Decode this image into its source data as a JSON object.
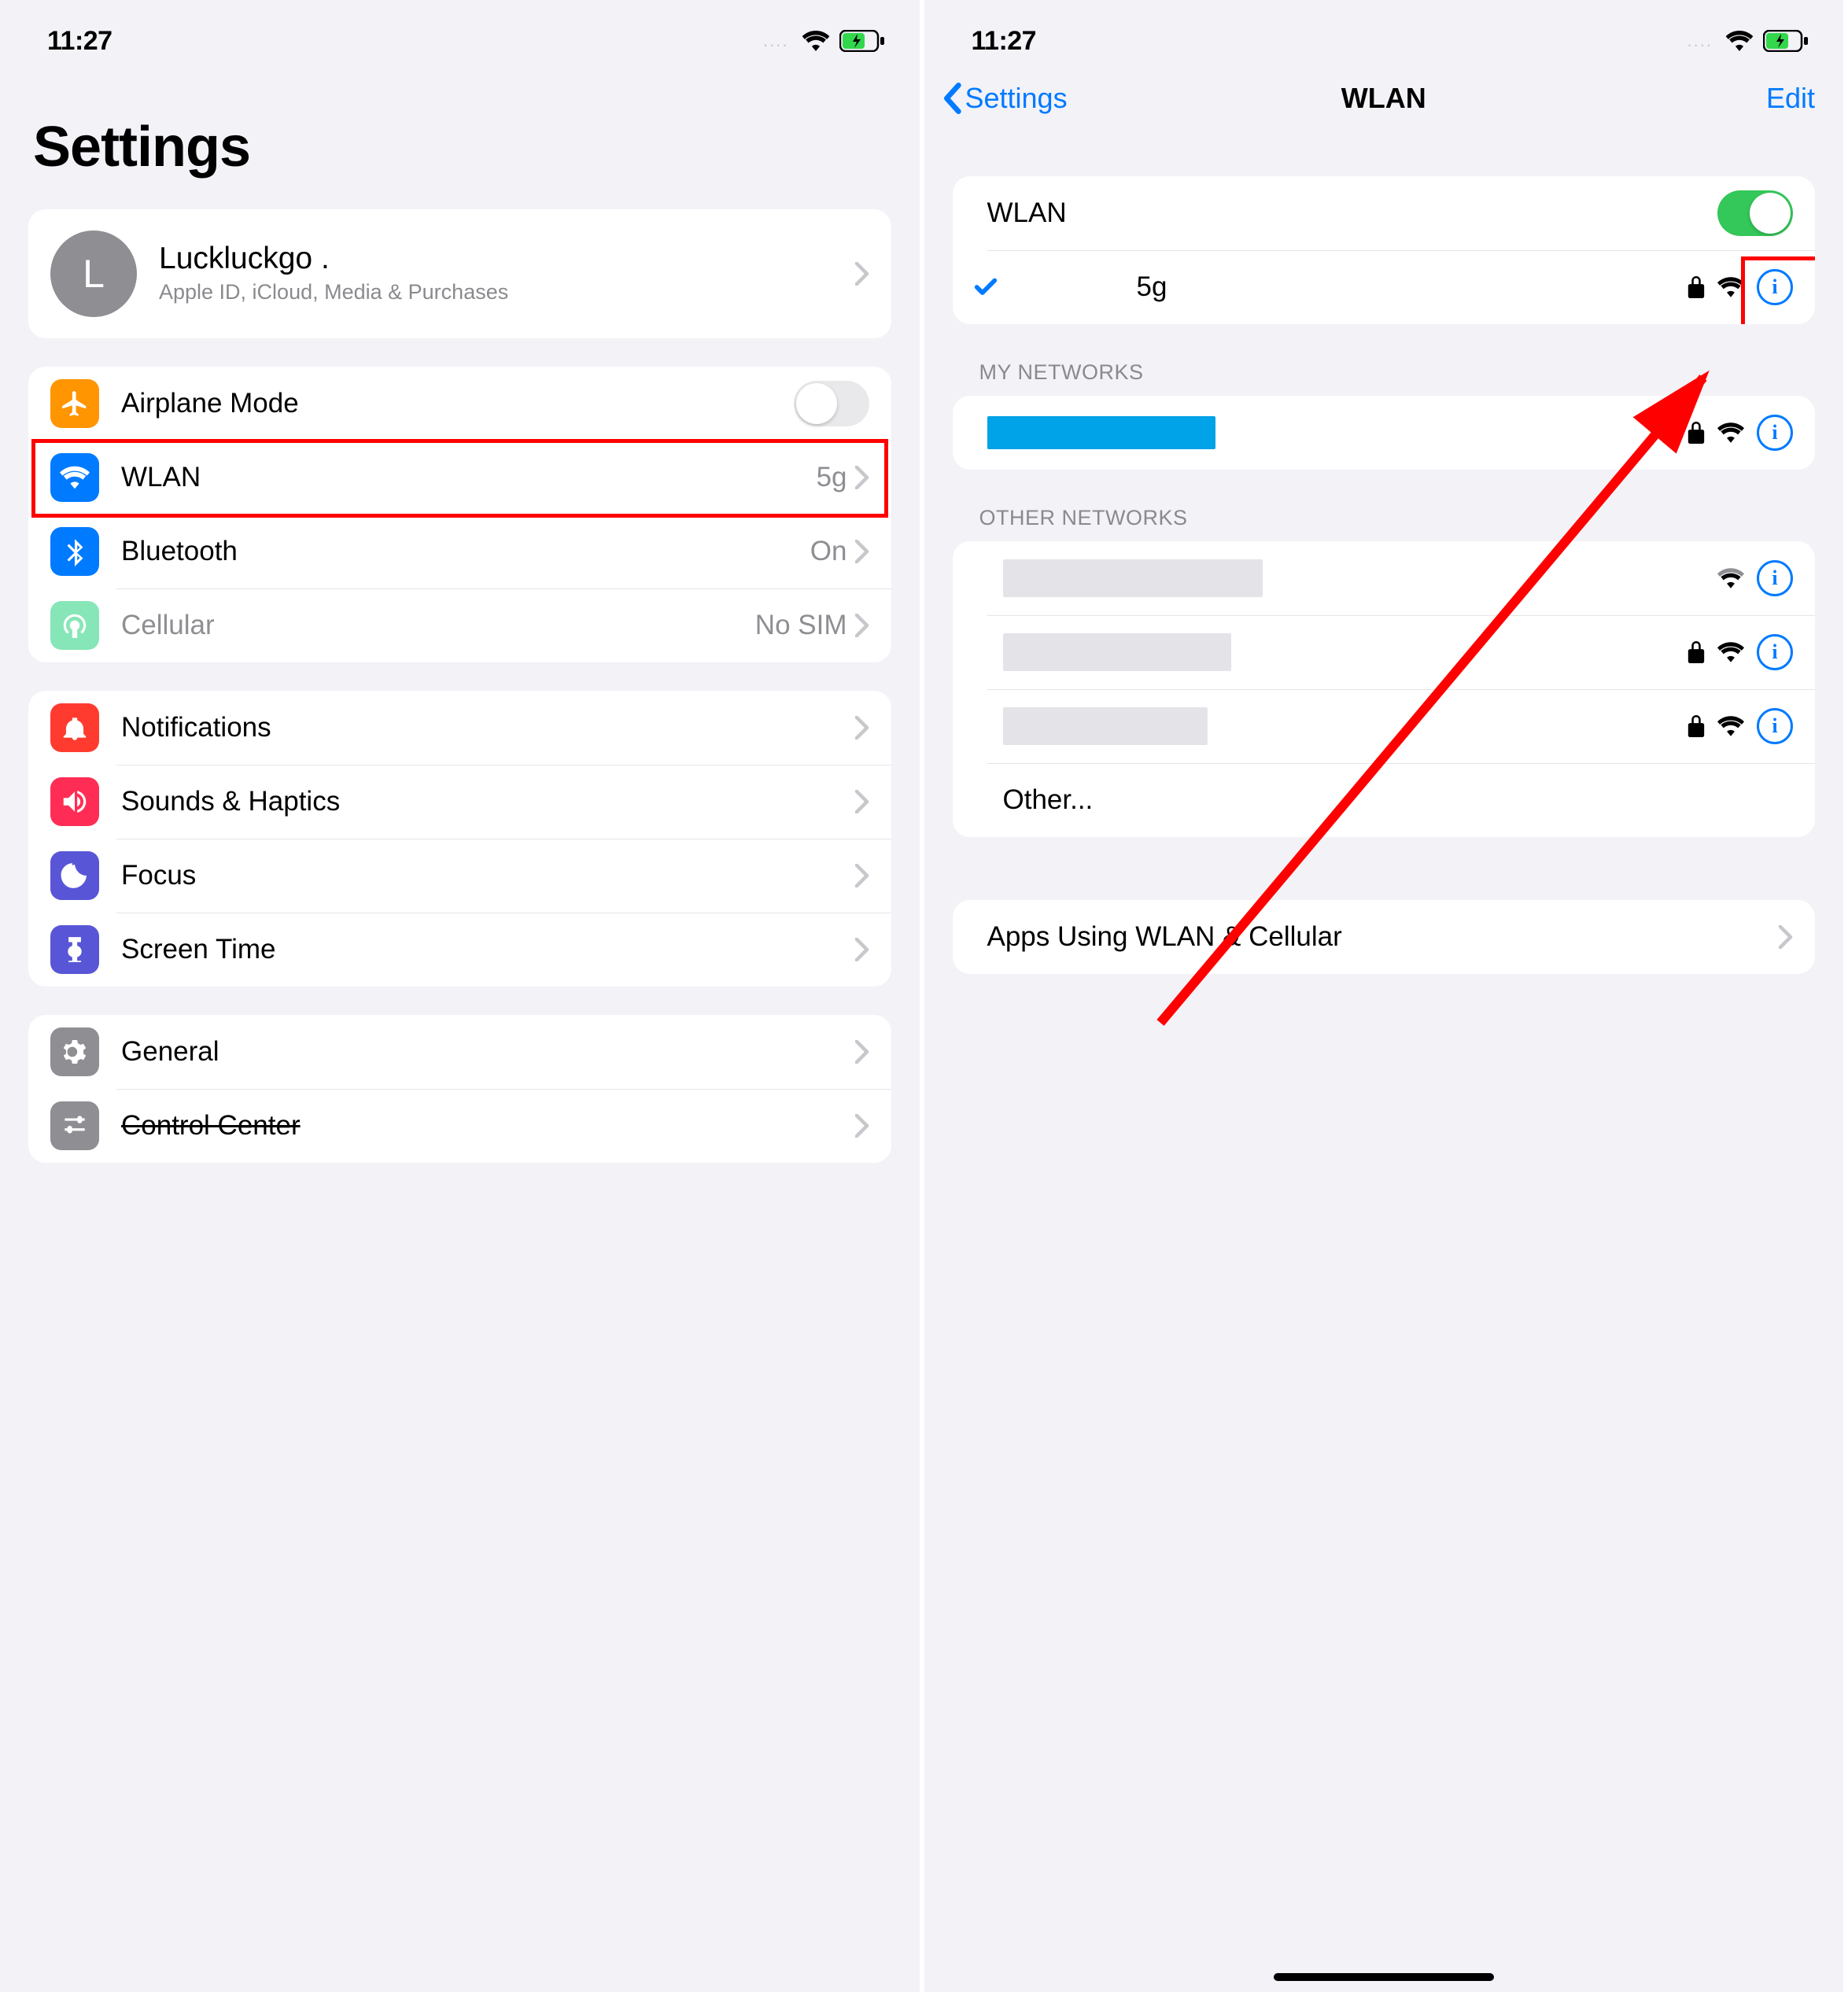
{
  "status": {
    "time": "11:27",
    "dots": "...."
  },
  "left": {
    "title": "Settings",
    "account": {
      "initial": "L",
      "name": "Luckluckgo .",
      "sub": "Apple ID, iCloud, Media & Purchases"
    },
    "rows1": {
      "airplane": "Airplane Mode",
      "wlan": "WLAN",
      "wlan_detail": "5g",
      "bluetooth": "Bluetooth",
      "bluetooth_detail": "On",
      "cellular": "Cellular",
      "cellular_detail": "No SIM"
    },
    "rows2": {
      "notifications": "Notifications",
      "sounds": "Sounds & Haptics",
      "focus": "Focus",
      "screentime": "Screen Time"
    },
    "rows3": {
      "general": "General",
      "control_center": "Control Center"
    }
  },
  "right": {
    "back": "Settings",
    "title": "WLAN",
    "edit": "Edit",
    "toggle_label": "WLAN",
    "connected_suffix": "5g",
    "section_my": "MY NETWORKS",
    "section_other": "OTHER NETWORKS",
    "other_label": "Other...",
    "apps_row": "Apps Using WLAN & Cellular"
  }
}
